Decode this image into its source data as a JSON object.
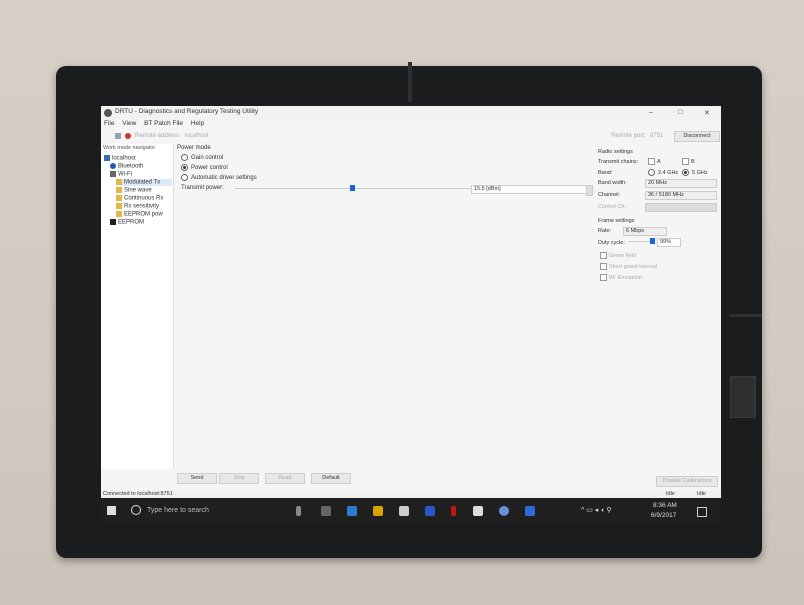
{
  "window": {
    "title": "DRTU - Diagnostics and Regulatory Testing Utility",
    "controls": [
      "–",
      "□",
      "✕"
    ]
  },
  "menu": [
    "File",
    "View",
    "BT Patch File",
    "Help"
  ],
  "toolbar": {
    "remote_address_label": "Remote address:",
    "remote_address_value": "localhost",
    "remote_port_label": "Remote port:",
    "remote_port_value": "8751",
    "disconnect_label": "Disconnect"
  },
  "sidebar": {
    "header": "Work mode navigator",
    "items": [
      {
        "label": "localhost",
        "icon": "computer-icon"
      },
      {
        "label": "Bluetooth",
        "icon": "bluetooth-icon"
      },
      {
        "label": "Wi-Fi",
        "icon": "wifi-icon"
      },
      {
        "label": "Modulated Tx",
        "icon": "folder-icon"
      },
      {
        "label": "Sine wave",
        "icon": "folder-icon"
      },
      {
        "label": "Continuous Rx",
        "icon": "folder-icon"
      },
      {
        "label": "Rx sensitivity",
        "icon": "folder-icon"
      },
      {
        "label": "EEPROM pow",
        "icon": "folder-icon"
      },
      {
        "label": "EEPROM",
        "icon": "chip-icon"
      }
    ]
  },
  "main": {
    "power_mode_label": "Power mode",
    "power_options": [
      {
        "label": "Gain control",
        "selected": false
      },
      {
        "label": "Power control",
        "selected": true
      },
      {
        "label": "Automatic driver settings",
        "selected": false
      }
    ],
    "transmit_power_label": "Transmit power:",
    "transmit_power_value": "15.5 [dBm]",
    "slider_level": 0.45
  },
  "radio_settings": {
    "header": "Radio settings",
    "transmit_chains_label": "Transmit chains:",
    "chain_a": "A",
    "chain_b": "B",
    "band_label": "Band:",
    "band_2_4": "2.4 GHz",
    "band_5": "5 GHz",
    "band_width_label": "Band width:",
    "band_width_value": "20 MHz",
    "channel_label": "Channel:",
    "channel_value": "36 / 5180 MHz",
    "control_ch_label": "Control Ch.:"
  },
  "frame_settings": {
    "header": "Frame settings",
    "rate_label": "Rate:",
    "rate_value": "6 Mbps",
    "duty_cycle_label": "Duty cycle:",
    "duty_cycle_value": "99%",
    "green_field": "Green field",
    "short_guard": "Short guard interval",
    "bf_emulation": "BF Emulation"
  },
  "actions": {
    "send": "Send",
    "stop": "Stop",
    "read": "Read",
    "default": "Default",
    "disable_calibrations": "Disable Calibrations"
  },
  "status": {
    "connection": "Connected to localhost:8751",
    "state": "Idle",
    "state2": "Idle"
  },
  "taskbar": {
    "search_placeholder": "Type here to search",
    "time": "8:36 AM",
    "date": "6/9/2017"
  }
}
